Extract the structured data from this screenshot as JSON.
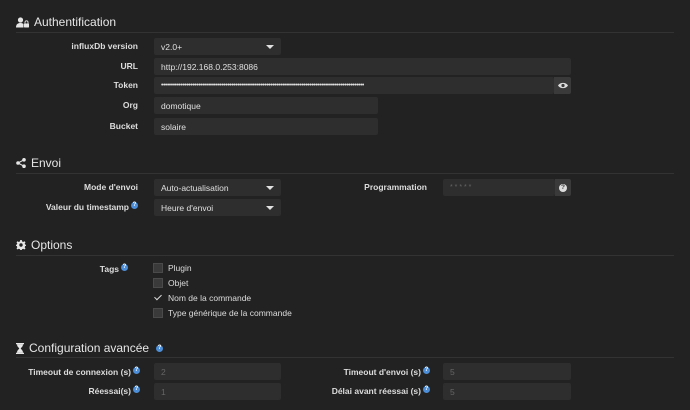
{
  "auth": {
    "title": "Authentification",
    "version_label": "influxDb version",
    "version_value": "v2.0+",
    "url_label": "URL",
    "url_value": "http://192.168.0.253:8086",
    "token_label": "Token",
    "token_value": "••••••••••••••••••••••••••••••••••••••••••••••••••••••••••••••••••••••••••••••••••••••••••••••••••••••••",
    "org_label": "Org",
    "org_value": "domotique",
    "bucket_label": "Bucket",
    "bucket_value": "solaire"
  },
  "envoi": {
    "title": "Envoi",
    "mode_label": "Mode d'envoi",
    "mode_value": "Auto-actualisation",
    "timestamp_label": "Valeur du timestamp",
    "timestamp_value": "Heure d'envoi",
    "prog_label": "Programmation",
    "prog_value": "* * * * *"
  },
  "options": {
    "title": "Options",
    "tags_label": "Tags",
    "tags": [
      {
        "label": "Plugin",
        "checked": false
      },
      {
        "label": "Objet",
        "checked": false
      },
      {
        "label": "Nom de la commande",
        "checked": true
      },
      {
        "label": "Type générique de la commande",
        "checked": false
      }
    ]
  },
  "advanced": {
    "title": "Configuration avancée",
    "timeout_conn_label": "Timeout de connexion (s)",
    "timeout_conn_value": "2",
    "retries_label": "Réessai(s)",
    "retries_value": "1",
    "timeout_send_label": "Timeout d'envoi (s)",
    "timeout_send_value": "5",
    "retry_delay_label": "Délai avant réessai (s)",
    "retry_delay_value": "5"
  },
  "help_glyph": "?",
  "icons": [
    "user-lock-icon",
    "share-icon",
    "gear-icon",
    "hourglass-icon",
    "eye-icon",
    "help-icon"
  ]
}
